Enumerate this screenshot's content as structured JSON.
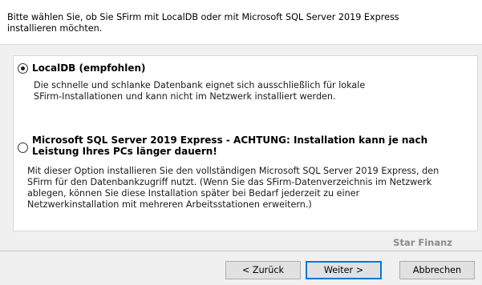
{
  "intro": {
    "line1": "Bitte wählen Sie, ob Sie SFirm mit LocalDB oder mit Microsoft SQL Server 2019 Express",
    "line2": "installieren möchten."
  },
  "options": [
    {
      "title": "LocalDB (empfohlen)",
      "selected": true,
      "desc_lines": [
        "Die schnelle und schlanke Datenbank eignet sich ausschließlich für lokale",
        "SFirm-Installationen und kann nicht im Netzwerk installiert werden."
      ]
    },
    {
      "title_lines": [
        "Microsoft SQL Server 2019 Express - ACHTUNG: Installation kann je nach",
        "Leistung Ihres PCs länger dauern!"
      ],
      "selected": false,
      "desc_lines": [
        "Mit dieser Option installieren Sie den vollständigen Microsoft SQL Server 2019 Express, den",
        "SFirm für den Datenbankzugriff nutzt. (Wenn Sie das SFirm-Datenverzeichnis im Netzwerk",
        "ablegen, können Sie diese Installation später bei Bedarf jederzeit zu einer",
        "Netzwerkinstallation mit mehreren Arbeitsstationen erweitern.)"
      ]
    }
  ],
  "brand": "Star Finanz",
  "buttons": {
    "back": "< Zurück",
    "next": "Weiter >",
    "cancel": "Abbrechen"
  }
}
